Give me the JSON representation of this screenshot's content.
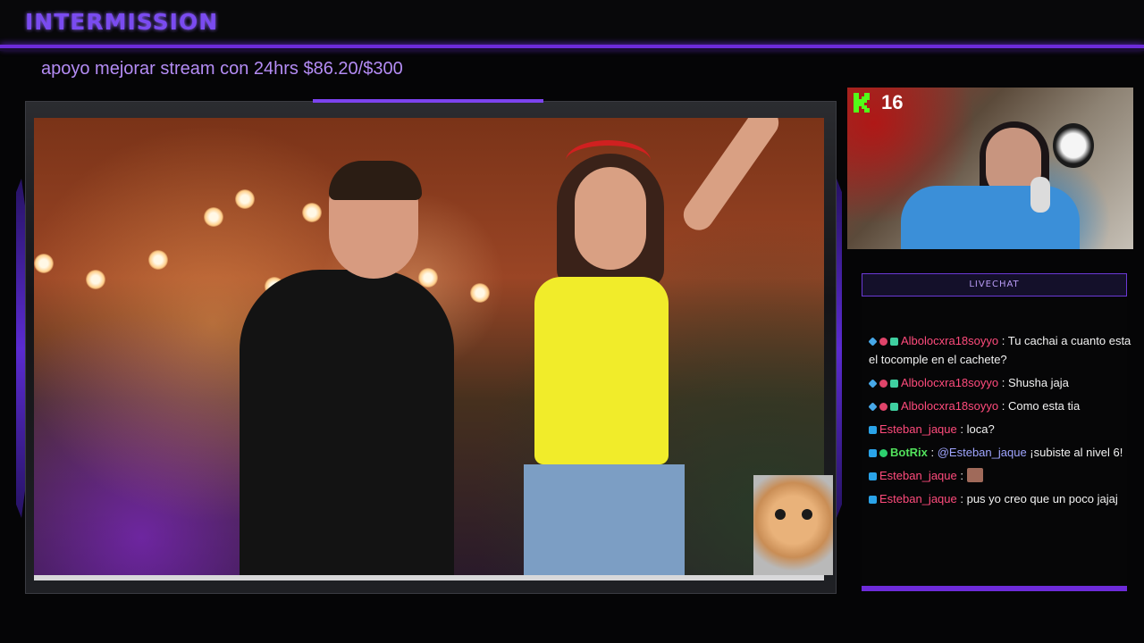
{
  "header": {
    "title": "INTERMISSION",
    "goal_text": "apoyo mejorar stream con 24hrs $86.20/$300"
  },
  "webcam": {
    "platform_icon": "kick-k-icon",
    "viewer_count": "16"
  },
  "livechat": {
    "header": "LIVECHAT",
    "messages": [
      {
        "user": "Albolocxra18soyyo",
        "sep": " : ",
        "text": "Tu cachai a cuanto esta el tocomple en el cachete?",
        "badges": [
          "cube",
          "heart",
          "gem"
        ]
      },
      {
        "user": "Albolocxra18soyyo",
        "sep": " : ",
        "text": "Shusha jaja",
        "badges": [
          "cube",
          "heart",
          "gem"
        ]
      },
      {
        "user": "Albolocxra18soyyo",
        "sep": " : ",
        "text": "Como esta tia",
        "badges": [
          "cube",
          "heart",
          "gem"
        ]
      },
      {
        "user": "Esteban_jaque",
        "sep": " : ",
        "text": "loca?",
        "badges": [
          "pencil"
        ]
      },
      {
        "user": "BotRix",
        "sep": " : ",
        "mention": "@Esteban_jaque",
        "text": " ¡subiste al nivel 6!",
        "badges": [
          "pencil",
          "shield"
        ]
      },
      {
        "user": "Esteban_jaque",
        "sep": " : ",
        "text": "",
        "emote": "face-emote",
        "badges": [
          "pencil"
        ]
      },
      {
        "user": "Esteban_jaque",
        "sep": " : ",
        "text": "pus yo creo que un poco jajaj",
        "badges": [
          "pencil"
        ]
      }
    ]
  },
  "colors": {
    "accent": "#6d2bd9",
    "username": "#ff4b7c",
    "bot": "#52e15c",
    "mention": "#9fa5ff"
  }
}
